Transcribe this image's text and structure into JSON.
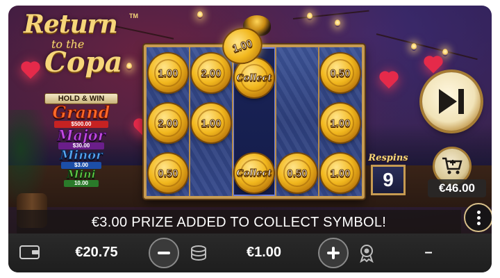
{
  "logo": {
    "line1": "Return",
    "line2": "to the",
    "line3": "Copa",
    "tm": "TM"
  },
  "jackpots": {
    "badge": "HOLD & WIN",
    "tiers": [
      {
        "name": "Grand",
        "value": "$500.00",
        "color": "#ff6a2a"
      },
      {
        "name": "Major",
        "value": "$30.00",
        "color": "#c24ae0"
      },
      {
        "name": "Minor",
        "value": "$3.00",
        "color": "#5aaaf2"
      },
      {
        "name": "Mini",
        "value": "10.00",
        "color": "#6ad04a"
      }
    ]
  },
  "reels": {
    "grid": [
      [
        "1.00",
        "2.00",
        "Collect",
        "",
        "0.50"
      ],
      [
        "2.00",
        "1.00",
        "",
        "",
        "1.00"
      ],
      [
        "0.50",
        "",
        "Collect",
        "0.50",
        "1.00"
      ]
    ],
    "flying_coin": "1.00"
  },
  "respins": {
    "label": "Respins",
    "count": "9"
  },
  "buttons": {
    "spin_icon": "play-skip-icon",
    "buy_icon": "cart-icon",
    "buy_price": "€46.00",
    "menu_icon": "more-vertical-icon"
  },
  "message": "€3.00 PRIZE ADDED TO COLLECT SYMBOL!",
  "bottombar": {
    "balance": "€20.75",
    "bet": "€1.00",
    "win": "–",
    "wallet_icon": "wallet-icon",
    "stack_icon": "coin-stack-icon",
    "badge_icon": "award-icon"
  },
  "colors": {
    "frame_gold": "#c79b52",
    "coin_gold": "#f2b81e"
  }
}
